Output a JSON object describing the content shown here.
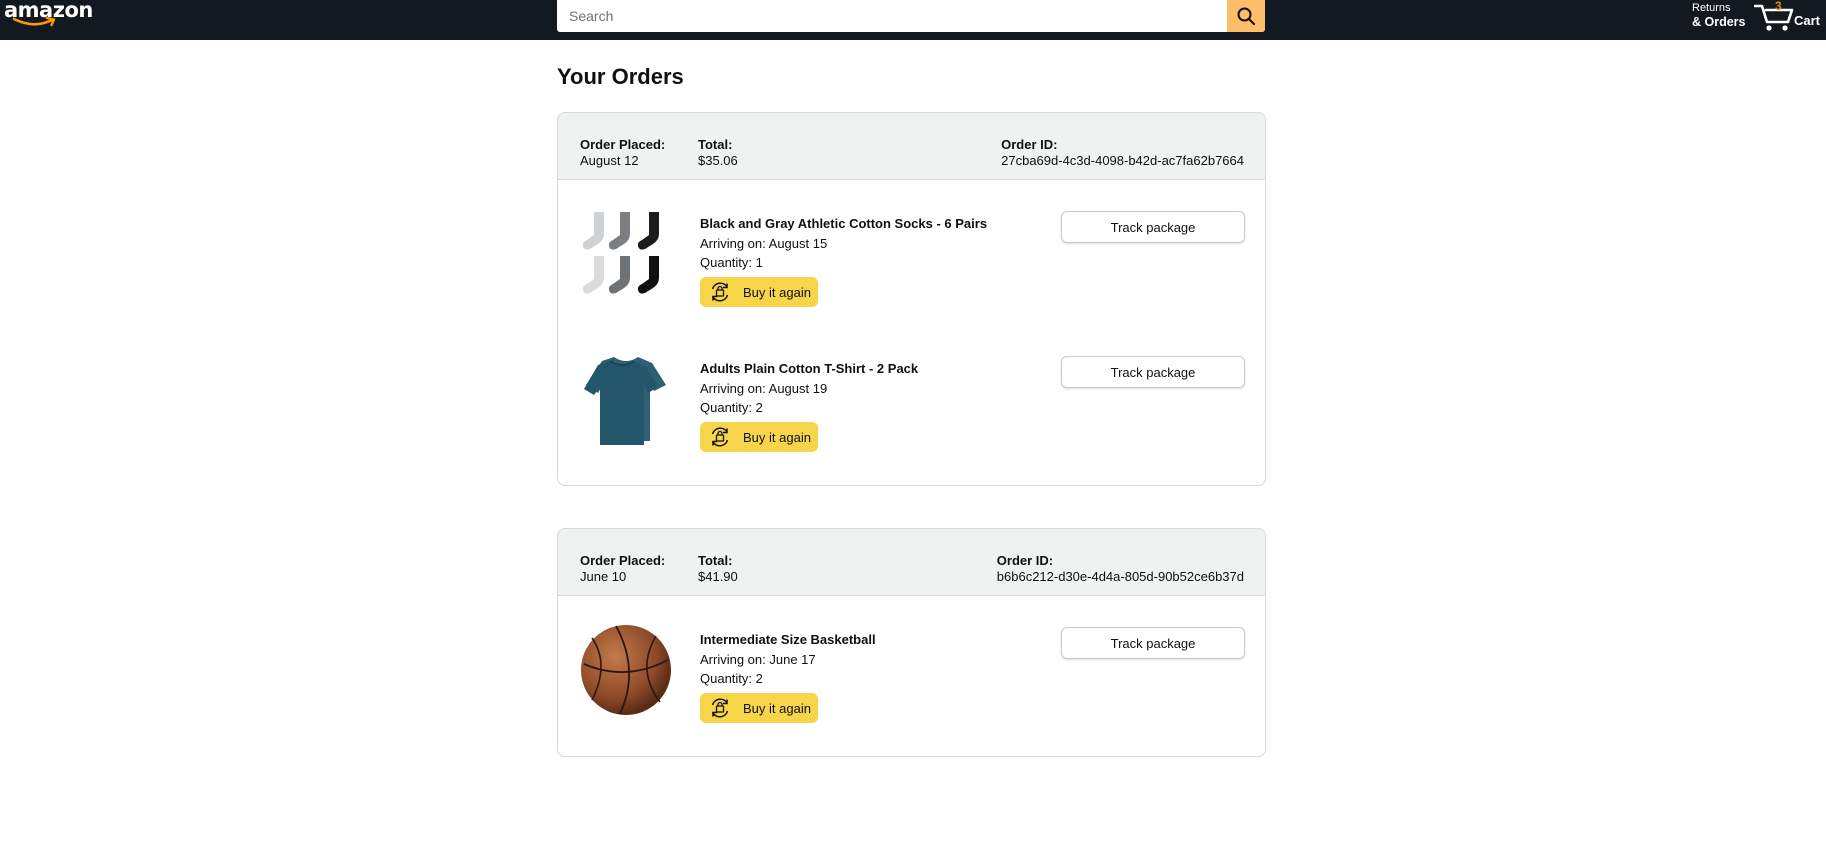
{
  "header": {
    "logo_text": "amazon",
    "search": {
      "placeholder": "Search",
      "value": ""
    },
    "returns_line1": "Returns",
    "returns_line2": "& Orders",
    "cart_count": "3",
    "cart_label": "Cart"
  },
  "page_title": "Your Orders",
  "colors": {
    "header_bg": "#131921",
    "search_button": "#febd69",
    "buy_again_button": "#f7d54a",
    "cart_count": "#f08804"
  },
  "orders": [
    {
      "placed_label": "Order Placed:",
      "placed_value": "August 12",
      "total_label": "Total:",
      "total_value": "$35.06",
      "id_label": "Order ID:",
      "id_value": "27cba69d-4c3d-4098-b42d-ac7fa62b7664",
      "items": [
        {
          "name": "Black and Gray Athletic Cotton Socks - 6 Pairs",
          "arriving": "Arriving on: August 15",
          "quantity": "Quantity: 1",
          "buy_again": "Buy it again",
          "track": "Track package",
          "image": "socks-image"
        },
        {
          "name": "Adults Plain Cotton T-Shirt - 2 Pack",
          "arriving": "Arriving on: August 19",
          "quantity": "Quantity: 2",
          "buy_again": "Buy it again",
          "track": "Track package",
          "image": "tshirt-image"
        }
      ]
    },
    {
      "placed_label": "Order Placed:",
      "placed_value": "June 10",
      "total_label": "Total:",
      "total_value": "$41.90",
      "id_label": "Order ID:",
      "id_value": "b6b6c212-d30e-4d4a-805d-90b52ce6b37d",
      "items": [
        {
          "name": "Intermediate Size Basketball",
          "arriving": "Arriving on: June 17",
          "quantity": "Quantity: 2",
          "buy_again": "Buy it again",
          "track": "Track package",
          "image": "basketball-image"
        }
      ]
    }
  ]
}
